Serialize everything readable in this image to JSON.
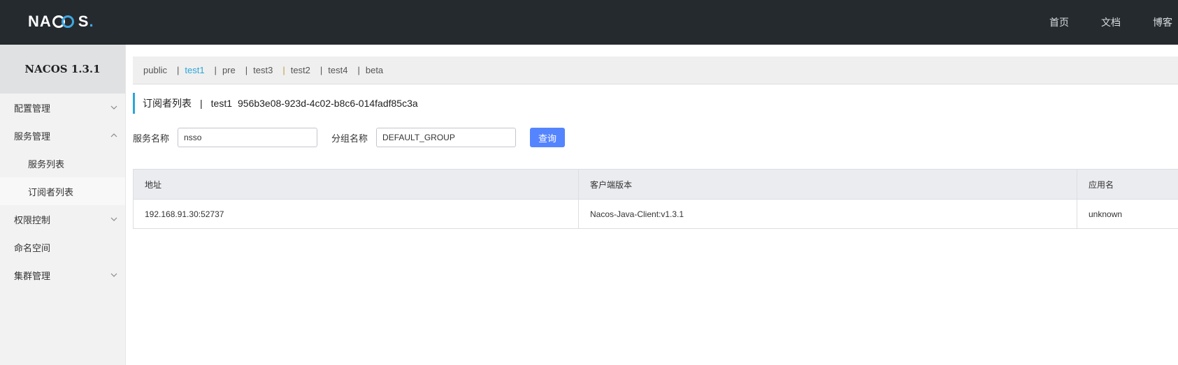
{
  "header": {
    "logo_text_left": "NA",
    "logo_text_right": "S",
    "logo_dot": ".",
    "nav": [
      "首页",
      "文档",
      "博客"
    ]
  },
  "sidebar": {
    "version": "NACOS 1.3.1",
    "items": [
      {
        "label": "配置管理",
        "expandable": true,
        "expanded": false
      },
      {
        "label": "服务管理",
        "expandable": true,
        "expanded": true
      },
      {
        "label": "服务列表",
        "sub": true
      },
      {
        "label": "订阅者列表",
        "sub": true,
        "active": true
      },
      {
        "label": "权限控制",
        "expandable": true,
        "expanded": false
      },
      {
        "label": "命名空间"
      },
      {
        "label": "集群管理",
        "expandable": true,
        "expanded": false
      }
    ]
  },
  "namespaces": {
    "items": [
      "public",
      "test1",
      "pre",
      "test3",
      "test2",
      "test4",
      "beta"
    ],
    "active": "test1"
  },
  "title": {
    "label": "订阅者列表",
    "separator": "|",
    "namespace_name": "test1",
    "namespace_id": "956b3e08-923d-4c02-b8c6-014fadf85c3a"
  },
  "search": {
    "service_name_label": "服务名称",
    "service_name_value": "nsso",
    "group_name_label": "分组名称",
    "group_name_value": "DEFAULT_GROUP",
    "query_button": "查询"
  },
  "table": {
    "columns": [
      "地址",
      "客户端版本",
      "应用名"
    ],
    "rows": [
      [
        "192.168.91.30:52737",
        "Nacos-Java-Client:v1.3.1",
        "unknown"
      ]
    ]
  },
  "colors": {
    "header_bg": "#252a2f",
    "accent": "#2ba6d8",
    "button": "#5584ff"
  }
}
